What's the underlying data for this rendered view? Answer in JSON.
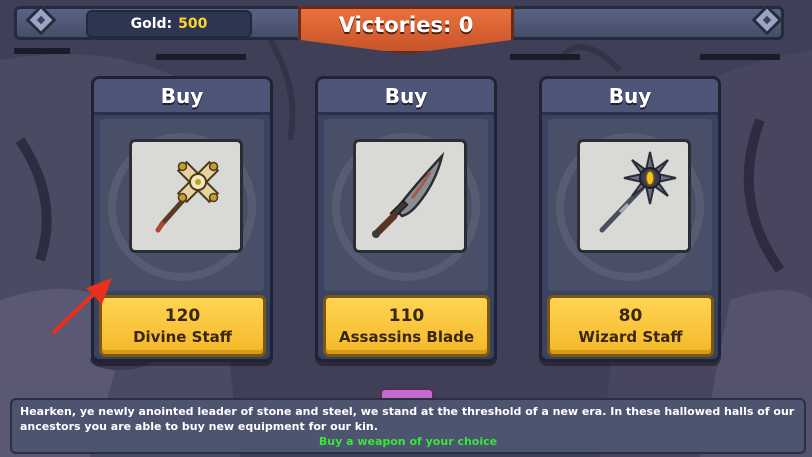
{
  "header": {
    "gold_label": "Gold:",
    "gold_value": "500",
    "victories_label": "Victories: 0"
  },
  "shop": {
    "items": [
      {
        "buy_label": "Buy",
        "price": "120",
        "name": "Divine Staff",
        "icon": "divine-staff-icon"
      },
      {
        "buy_label": "Buy",
        "price": "110",
        "name": "Assassins Blade",
        "icon": "assassins-blade-icon"
      },
      {
        "buy_label": "Buy",
        "price": "80",
        "name": "Wizard Staff",
        "icon": "wizard-staff-icon"
      }
    ]
  },
  "dialog": {
    "text": "Hearken, ye newly anointed leader of stone and steel, we stand at the threshold of a new era. In these hallowed halls of our ancestors you are able to buy new equipment for our kin.",
    "hint": "Buy a weapon of your choice"
  },
  "colors": {
    "accent_orange": "#d85f30",
    "gold_text": "#ffd42a",
    "button_yellow": "#f4b828",
    "hint_green": "#39e639",
    "arrow_red": "#e8301c"
  }
}
